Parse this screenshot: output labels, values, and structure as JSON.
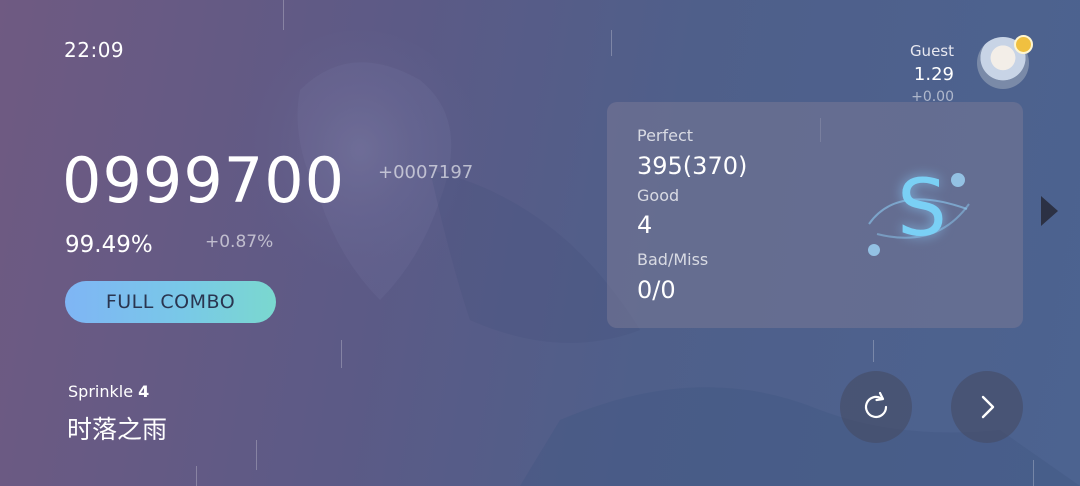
{
  "status": {
    "clock": "22:09"
  },
  "player": {
    "name": "Guest",
    "rating": "1.29",
    "rating_delta": "+0.00",
    "avatar_icon": "player-avatar"
  },
  "result": {
    "score": "0999700",
    "score_delta": "+0007197",
    "accuracy": "99.49%",
    "accuracy_delta": "+0.87%",
    "clear_badge": "FULL COMBO"
  },
  "chart": {
    "difficulty": "Sprinkle",
    "level": "4",
    "song_title": "时落之雨"
  },
  "judgements": {
    "perfect_label": "Perfect",
    "perfect_value": "395(370)",
    "good_label": "Good",
    "good_value": "4",
    "badmiss_label": "Bad/Miss",
    "badmiss_value": "0/0"
  },
  "grade": {
    "letter": "S",
    "color": "#7ad0f5"
  },
  "controls": {
    "retry_icon": "retry-icon",
    "next_icon": "chevron-right-icon",
    "side_icon": "triangle-right-icon"
  }
}
